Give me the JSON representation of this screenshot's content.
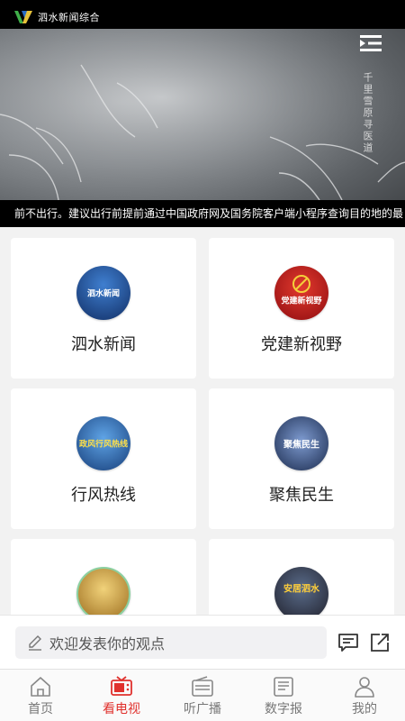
{
  "video": {
    "channel_name": "泗水新闻综合",
    "vertical_caption": "千里雪原寻医道",
    "ticker_text": "前不出行。建议出行前提前通过中国政府网及国务院客户端小程序查询目的地的最"
  },
  "cards": [
    {
      "label": "泗水新闻",
      "logo_text": "泗水新闻",
      "logo_color": "#1f4f9a"
    },
    {
      "label": "党建新视野",
      "logo_text": "党建新视野",
      "logo_color": "#c4161c"
    },
    {
      "label": "行风热线",
      "logo_text": "政风行风热线",
      "logo_color": "#1e5aa8"
    },
    {
      "label": "聚焦民生",
      "logo_text": "聚焦民生",
      "logo_color": "#2a3f6b"
    },
    {
      "label": "",
      "logo_text": "",
      "logo_color": "#d9b24a"
    },
    {
      "label": "",
      "logo_text": "安居泗水",
      "logo_color": "#8a2a1a"
    }
  ],
  "comment": {
    "placeholder": "欢迎发表你的观点",
    "icons": [
      "comment-icon",
      "share-icon"
    ]
  },
  "nav": {
    "items": [
      {
        "label": "首页",
        "icon": "home-icon",
        "active": false
      },
      {
        "label": "看电视",
        "icon": "tv-icon",
        "active": true
      },
      {
        "label": "听广播",
        "icon": "radio-icon",
        "active": false
      },
      {
        "label": "数字报",
        "icon": "newspaper-icon",
        "active": false
      },
      {
        "label": "我的",
        "icon": "user-icon",
        "active": false
      }
    ]
  },
  "colors": {
    "accent": "#e0312d",
    "inactive": "#777777"
  }
}
